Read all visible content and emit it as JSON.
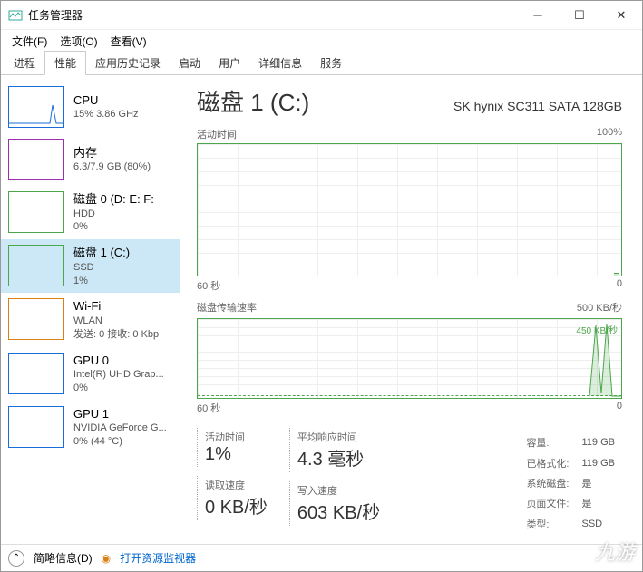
{
  "window": {
    "title": "任务管理器"
  },
  "menus": {
    "file": "文件(F)",
    "options": "选项(O)",
    "view": "查看(V)"
  },
  "tabs": [
    "进程",
    "性能",
    "应用历史记录",
    "启动",
    "用户",
    "详细信息",
    "服务"
  ],
  "activeTab": "性能",
  "sidebar": [
    {
      "name": "CPU",
      "sub1": "15% 3.86 GHz",
      "color": "#1a6dd6"
    },
    {
      "name": "内存",
      "sub1": "6.3/7.9 GB (80%)",
      "color": "#9b2fae"
    },
    {
      "name": "磁盘 0 (D: E: F:",
      "sub1": "HDD",
      "sub2": "0%",
      "color": "#4ca64c"
    },
    {
      "name": "磁盘 1 (C:)",
      "sub1": "SSD",
      "sub2": "1%",
      "color": "#4ca64c",
      "active": true
    },
    {
      "name": "Wi-Fi",
      "sub1": "WLAN",
      "sub2": "发送: 0 接收: 0 Kbp",
      "color": "#d98018"
    },
    {
      "name": "GPU 0",
      "sub1": "Intel(R) UHD Grap...",
      "sub2": "0%",
      "color": "#1a6dd6"
    },
    {
      "name": "GPU 1",
      "sub1": "NVIDIA GeForce G...",
      "sub2": "0% (44 °C)",
      "color": "#1a6dd6"
    }
  ],
  "main": {
    "title": "磁盘 1 (C:)",
    "model": "SK hynix SC311 SATA 128GB",
    "chart1": {
      "label": "活动时间",
      "max": "100%",
      "xleft": "60 秒",
      "xright": "0"
    },
    "chart2": {
      "label": "磁盘传输速率",
      "max": "500 KB/秒",
      "annot": "450 KB/秒",
      "xleft": "60 秒",
      "xright": "0"
    },
    "stats": {
      "active": {
        "label": "活动时间",
        "value": "1%"
      },
      "resp": {
        "label": "平均响应时间",
        "value": "4.3 毫秒"
      },
      "read": {
        "label": "读取速度",
        "value": "0 KB/秒"
      },
      "write": {
        "label": "写入速度",
        "value": "603 KB/秒"
      }
    },
    "kv": {
      "capacity": {
        "k": "容量:",
        "v": "119 GB"
      },
      "formatted": {
        "k": "已格式化:",
        "v": "119 GB"
      },
      "sysdisk": {
        "k": "系统磁盘:",
        "v": "是"
      },
      "pagefile": {
        "k": "页面文件:",
        "v": "是"
      },
      "type": {
        "k": "类型:",
        "v": "SSD"
      }
    }
  },
  "footer": {
    "brief": "简略信息(D)",
    "resmon": "打开资源监视器"
  },
  "watermark": "九游"
}
